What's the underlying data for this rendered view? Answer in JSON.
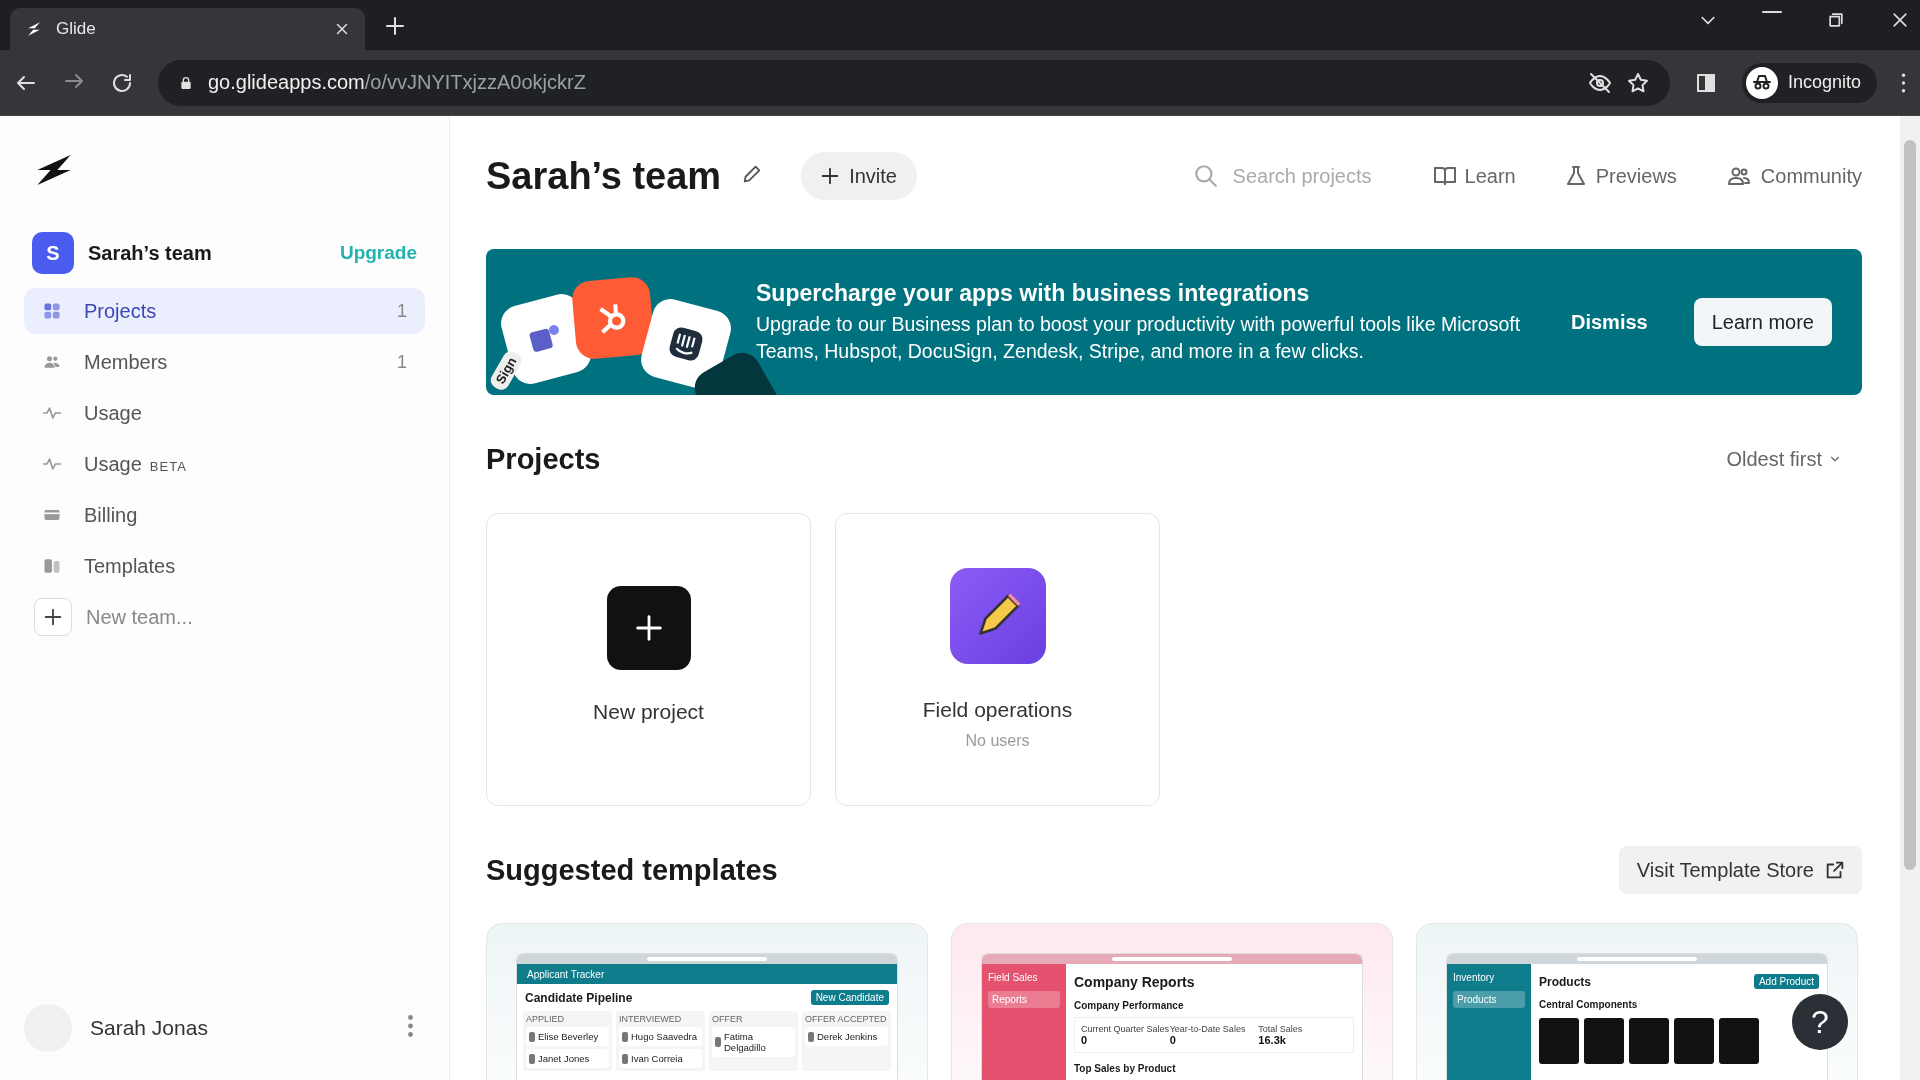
{
  "browser": {
    "tab_title": "Glide",
    "url_host": "go.glideapps.com",
    "url_path": "/o/vvJNYITxjzzA0okjckrZ",
    "profile": "Incognito"
  },
  "sidebar": {
    "team": {
      "initial": "S",
      "name": "Sarah’s team",
      "upgrade": "Upgrade"
    },
    "items": [
      {
        "kind": "grid",
        "label": "Projects",
        "count": "1",
        "selected": true
      },
      {
        "kind": "people",
        "label": "Members",
        "count": "1",
        "selected": false
      },
      {
        "kind": "pulse",
        "label": "Usage",
        "selected": false
      },
      {
        "kind": "pulse",
        "label": "Usage",
        "badge": "BETA",
        "selected": false
      },
      {
        "kind": "card",
        "label": "Billing",
        "selected": false
      },
      {
        "kind": "book",
        "label": "Templates",
        "selected": false
      }
    ],
    "new_team": "New team...",
    "user": {
      "name": "Sarah Jonas"
    }
  },
  "header": {
    "title": "Sarah’s team",
    "invite": "Invite",
    "search_placeholder": "Search projects",
    "links": [
      {
        "kind": "book",
        "label": "Learn"
      },
      {
        "kind": "flask",
        "label": "Previews"
      },
      {
        "kind": "people",
        "label": "Community"
      }
    ]
  },
  "banner": {
    "logo_text": "Sign",
    "title": "Supercharge your apps with business integrations",
    "text": "Upgrade to our Business plan to boost your productivity with powerful tools like Microsoft Teams, Hubspot, DocuSign, Zendesk, Stripe, and more in a few clicks.",
    "dismiss": "Dismiss",
    "learn_more": "Learn more"
  },
  "projects": {
    "heading": "Projects",
    "sort": "Oldest first",
    "cards": [
      {
        "kind": "new",
        "label": "New project"
      },
      {
        "kind": "app",
        "name": "Field operations",
        "subtitle": "No users"
      }
    ]
  },
  "templates": {
    "heading": "Suggested templates",
    "store_button": "Visit Template Store",
    "cards": [
      {
        "kind": "pipeline",
        "app_name": "Applicant Tracker",
        "title": "Candidate Pipeline",
        "button": "New Candidate",
        "columns": [
          {
            "name": "APPLIED",
            "people": [
              "Elise Beverley",
              "Janet Jones"
            ]
          },
          {
            "name": "INTERVIEWED",
            "people": [
              "Hugo Saavedra",
              "Ivan Correia"
            ]
          },
          {
            "name": "OFFER",
            "people": [
              "Fatima Delgadillo"
            ]
          },
          {
            "name": "OFFER ACCEPTED",
            "people": [
              "Derek Jenkins"
            ]
          }
        ]
      },
      {
        "kind": "reports",
        "app_name": "Field Sales",
        "nav": "Reports",
        "title": "Company Reports",
        "section": "Company Performance",
        "stats": [
          {
            "label": "Current Quarter Sales",
            "value": "0"
          },
          {
            "label": "Year-to-Date Sales",
            "value": "0"
          },
          {
            "label": "Total Sales",
            "value": "16.3k"
          }
        ],
        "section2": "Top Sales by Product"
      },
      {
        "kind": "inventory",
        "app_name": "Inventory",
        "nav": "Products",
        "title": "Products",
        "button": "Add Product",
        "section": "Central Components"
      }
    ]
  },
  "help_button": "?"
}
